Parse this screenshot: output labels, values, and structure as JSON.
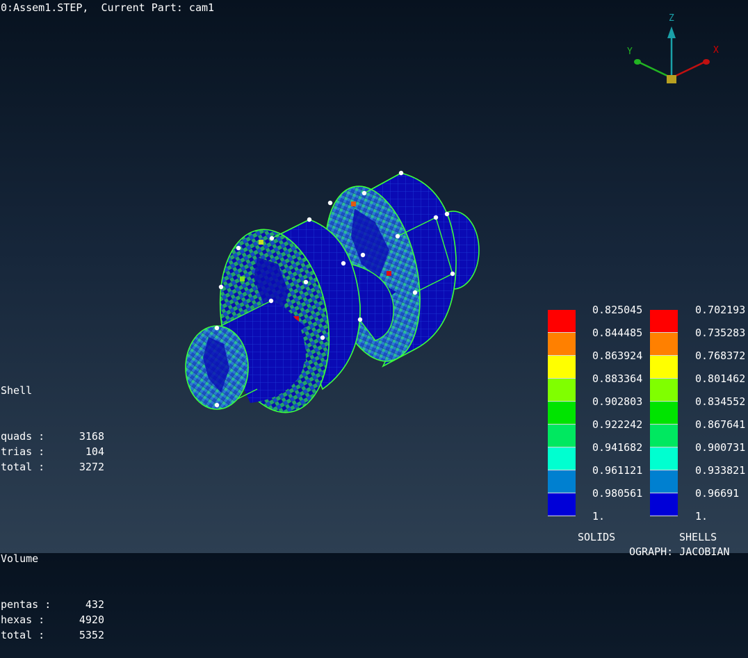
{
  "header": {
    "text": "0:Assem1.STEP,  Current Part: cam1"
  },
  "axes": {
    "x": "X",
    "y": "Y",
    "z": "Z",
    "colors": {
      "x": "#d40000",
      "y": "#22b422",
      "z": "#1aa0a8",
      "origin": "#b8a020"
    }
  },
  "stats": {
    "shell": {
      "title": "Shell",
      "rows": [
        {
          "label": "quads :",
          "value": "3168"
        },
        {
          "label": "trias :",
          "value": "104"
        },
        {
          "label": "total :",
          "value": "3272"
        }
      ]
    },
    "volume": {
      "title": "Volume",
      "rows": [
        {
          "label": "pentas :",
          "value": "432"
        },
        {
          "label": "hexas :",
          "value": "4920"
        },
        {
          "label": "total :",
          "value": "5352"
        }
      ]
    }
  },
  "legend": {
    "colors": [
      "#ff0000",
      "#ff8000",
      "#ffff00",
      "#80ff00",
      "#00e400",
      "#00e860",
      "#00ffd0",
      "#0080d0",
      "#0000d8"
    ],
    "solids": {
      "title": "SOLIDS",
      "values": [
        "0.825045",
        "0.844485",
        "0.863924",
        "0.883364",
        "0.902803",
        "0.922242",
        "0.941682",
        "0.961121",
        "0.980561",
        "1."
      ]
    },
    "shells": {
      "title": "SHELLS",
      "values": [
        "0.702193",
        "0.735283",
        "0.768372",
        "0.801462",
        "0.834552",
        "0.867641",
        "0.900731",
        "0.933821",
        "0.96691",
        "1."
      ]
    }
  },
  "graph_label": "OGRAPH: JACOBIAN"
}
